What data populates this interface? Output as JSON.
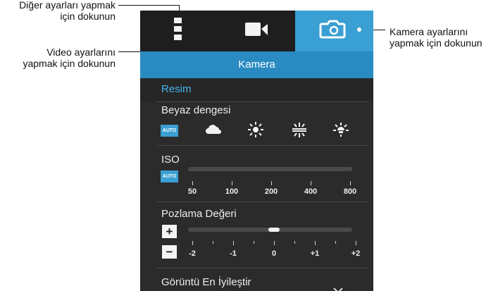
{
  "callouts": {
    "more_settings": {
      "line1": "Diğer ayarları yapmak",
      "line2": "için dokunun"
    },
    "video_settings": {
      "line1": "Video ayarlarını",
      "line2": "yapmak için dokunun"
    },
    "camera_settings": {
      "line1": "Kamera ayarlarını",
      "line2": "yapmak için dokunun"
    }
  },
  "header": {
    "title": "Kamera"
  },
  "sections": {
    "picture": "Resim"
  },
  "white_balance": {
    "label": "Beyaz dengesi",
    "auto": "AUTO",
    "options": [
      "cloudy-icon",
      "sunny-icon",
      "fluorescent-icon",
      "incandescent-icon"
    ]
  },
  "iso": {
    "label": "ISO",
    "auto": "AUTO",
    "values": [
      "50",
      "100",
      "200",
      "400",
      "800"
    ]
  },
  "exposure": {
    "label": "Pozlama Değeri",
    "plus": "+",
    "minus": "−",
    "labels": [
      "-2",
      "-1",
      "0",
      "+1",
      "+2"
    ],
    "current_value": 0
  },
  "optimize": {
    "label": "Görüntü En İyileştir"
  },
  "colors": {
    "accent": "#3a9fd2",
    "title_bar": "#2a8bc2",
    "section_text": "#45b5ee",
    "panel_bg": "#2b2b2b"
  }
}
